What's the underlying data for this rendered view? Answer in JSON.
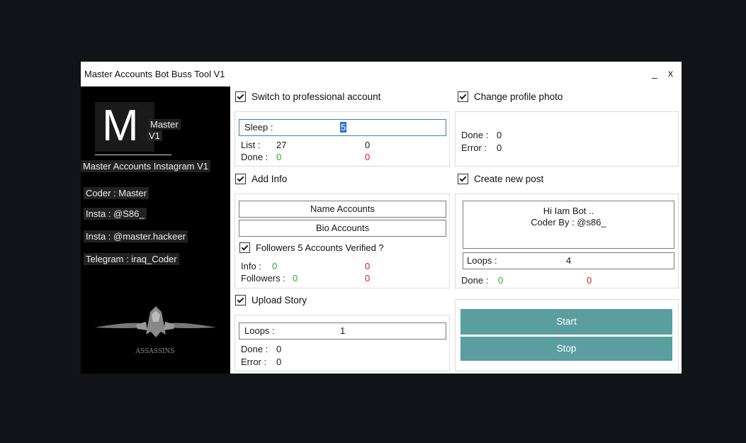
{
  "window": {
    "title": "Master Accounts Bot Buss Tool V1",
    "minimize": "_",
    "close": "x"
  },
  "sidebar": {
    "logo_letter": "M",
    "logo_line1": "Master",
    "logo_line2": "V1",
    "app_name": "Master Accounts Instagram V1",
    "coder": "Coder : Master",
    "insta1": "Insta : @S86_",
    "insta2": "Insta : @master.hackeer",
    "telegram": "Telegram : iraq_Coder",
    "emblem_text": "ASSASSINS"
  },
  "professional": {
    "checkbox_label": "Switch to professional account",
    "sleep_label": "Sleep :",
    "sleep_value": "5",
    "list_label": "List :",
    "list_value": "27",
    "list_error": "0",
    "done_label": "Done :",
    "done_value": "0",
    "done_error": "0"
  },
  "profile_photo": {
    "checkbox_label": "Change profile photo",
    "done_label": "Done :",
    "done_value": "0",
    "error_label": "Error :",
    "error_value": "0"
  },
  "add_info": {
    "checkbox_label": "Add Info",
    "name_button": "Name Accounts",
    "bio_button": "Bio Accounts",
    "followers_checkbox": "Followers 5 Accounts Verified ?",
    "info_label": "Info :",
    "info_value": "0",
    "info_error": "0",
    "followers_label": "Followers :",
    "followers_value": "0",
    "followers_error": "0"
  },
  "new_post": {
    "checkbox_label": "Create new post",
    "caption_line1": "Hi Iam Bot ..",
    "caption_line2": "Coder By : @s86_",
    "loops_label": "Loops :",
    "loops_value": "4",
    "done_label": "Done :",
    "done_value": "0",
    "done_error": "0"
  },
  "upload_story": {
    "checkbox_label": "Upload Story",
    "loops_label": "Loops :",
    "loops_value": "1",
    "done_label": "Done :",
    "done_value": "0",
    "error_label": "Error :",
    "error_value": "0"
  },
  "actions": {
    "start": "Start",
    "stop": "Stop"
  },
  "colors": {
    "accent": "#5a9ea0",
    "success": "#1db31d",
    "error": "#e01919",
    "background": "#121318"
  }
}
